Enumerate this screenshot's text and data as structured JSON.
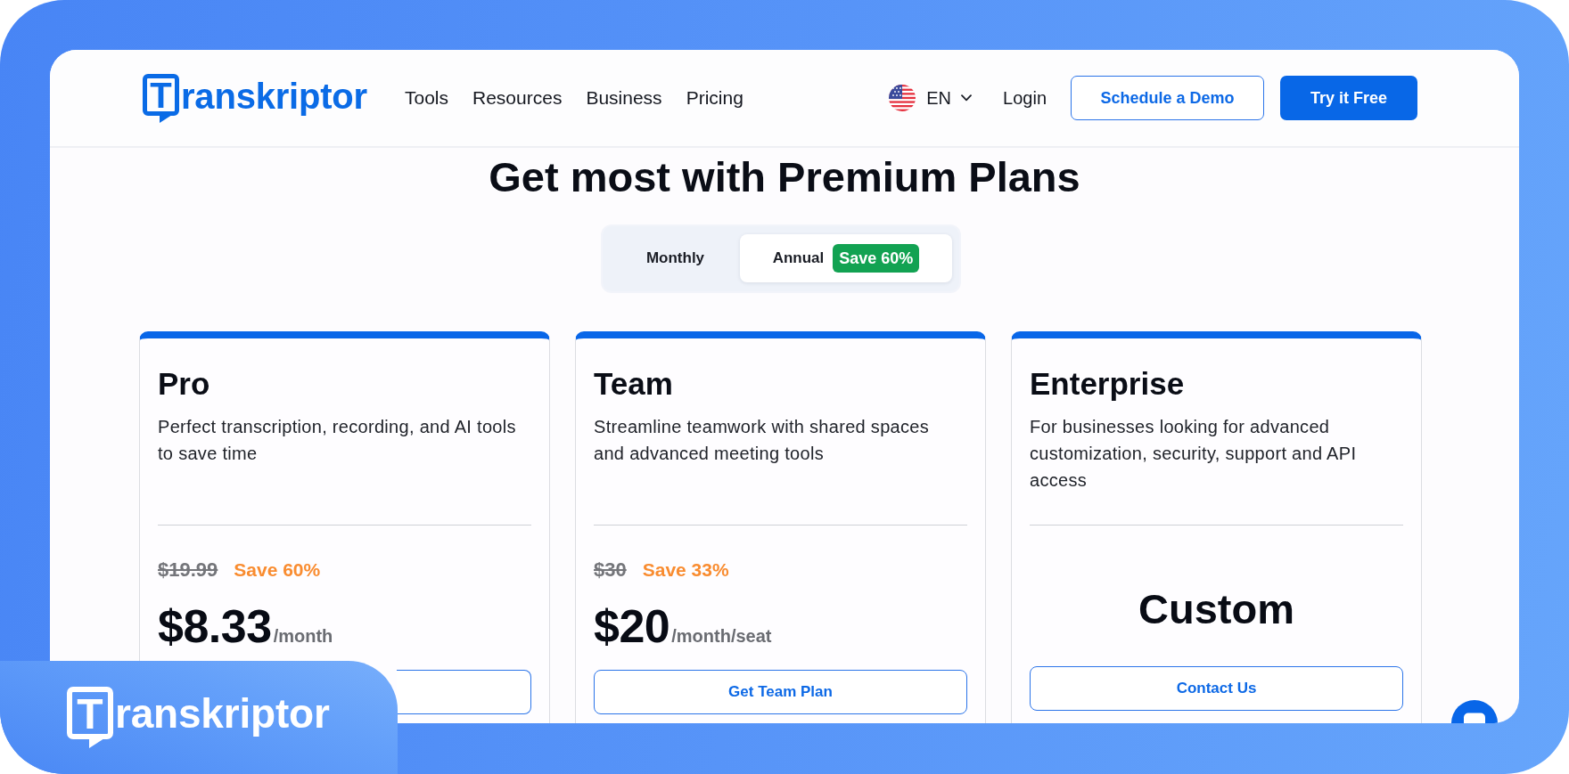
{
  "header": {
    "logo": {
      "letter": "T",
      "text": "ranskriptor"
    },
    "nav": [
      "Tools",
      "Resources",
      "Business",
      "Pricing"
    ],
    "language": "EN",
    "login": "Login",
    "buttons": [
      {
        "label": "Schedule a Demo",
        "kind": "outline"
      },
      {
        "label": "Try it Free",
        "kind": "primary"
      }
    ]
  },
  "pricing": {
    "title": "Get most with Premium Plans",
    "billing_tabs": [
      {
        "label": "Monthly",
        "selected": false
      },
      {
        "label": "Annual",
        "selected": true,
        "badge": "Save 60%"
      }
    ],
    "plans": [
      {
        "name": "Pro",
        "description": "Perfect transcription, recording, and AI tools to save time",
        "kind": "discounted",
        "old_price": "$19.99",
        "saving": "Save 60%",
        "price": "$8.33",
        "period": "/month",
        "button": {
          "kind": "clipped"
        }
      },
      {
        "name": "Team",
        "description": "Streamline teamwork with shared spaces and advanced meeting tools",
        "kind": "discounted",
        "old_price": "$30",
        "saving": "Save 33%",
        "price": "$20",
        "period": "/month/seat",
        "button": {
          "kind": "outline",
          "label": "Get Team Plan"
        }
      },
      {
        "name": "Enterprise",
        "description": "For businesses looking for advanced customization, security, support and API access",
        "kind": "custom",
        "price": "Custom",
        "button": {
          "kind": "outline",
          "label": "Contact Us"
        }
      }
    ]
  },
  "frame_badge": {
    "logo": {
      "letter": "T",
      "text": "ranskriptor"
    }
  }
}
